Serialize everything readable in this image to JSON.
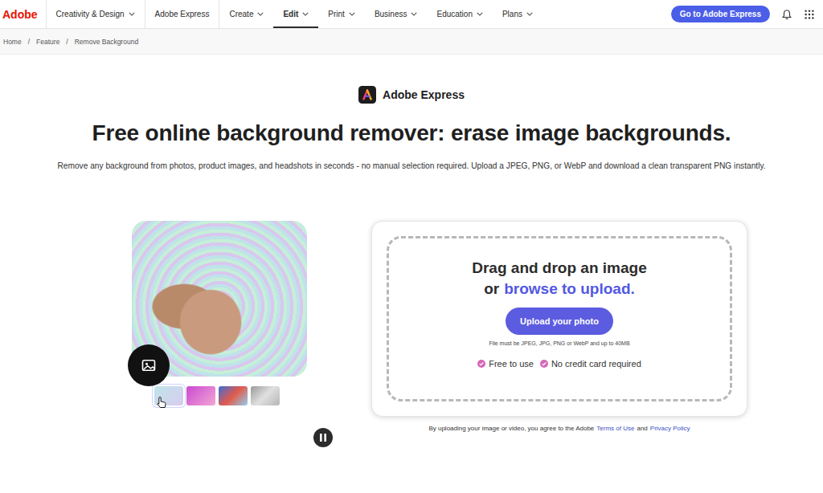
{
  "nav": {
    "brand": "Adobe",
    "items": [
      {
        "label": "Creativity & Design",
        "menu": true,
        "selected": false
      },
      {
        "label": "Adobe Express",
        "menu": false,
        "selected": false
      },
      {
        "label": "Create",
        "menu": true,
        "selected": false
      },
      {
        "label": "Edit",
        "menu": true,
        "selected": true
      },
      {
        "label": "Print",
        "menu": true,
        "selected": false
      },
      {
        "label": "Business",
        "menu": true,
        "selected": false
      },
      {
        "label": "Education",
        "menu": true,
        "selected": false
      },
      {
        "label": "Plans",
        "menu": true,
        "selected": false
      }
    ],
    "cta": "Go to Adobe Express"
  },
  "breadcrumb": {
    "separator": "/",
    "items": [
      "Home",
      "Feature",
      "Remove Background"
    ]
  },
  "product": "Adobe Express",
  "heading": "Free online background remover: erase image backgrounds.",
  "subheading": "Remove any background from photos, product images, and headshots in seconds - no manual selection required. Upload a JPEG, PNG, or WebP and download a clean transparent PNG instantly.",
  "preview": {
    "playing": true,
    "thumbnails": [
      {
        "selected": true
      },
      {
        "selected": false
      },
      {
        "selected": false
      },
      {
        "selected": false
      }
    ]
  },
  "upload": {
    "title": "Drag and drop an image",
    "prefix": "or",
    "link": "browse to upload.",
    "button": "Upload your photo",
    "note": "File must be JPEG, JPG, PNG or WebP and up to 40MB",
    "perks": [
      "Free to use",
      "No credit card required"
    ]
  },
  "legal": {
    "prefix": "By uploading your image or video, you agree to the Adobe",
    "terms": "Terms of Use",
    "and": "and",
    "privacy": "Privacy Policy"
  }
}
